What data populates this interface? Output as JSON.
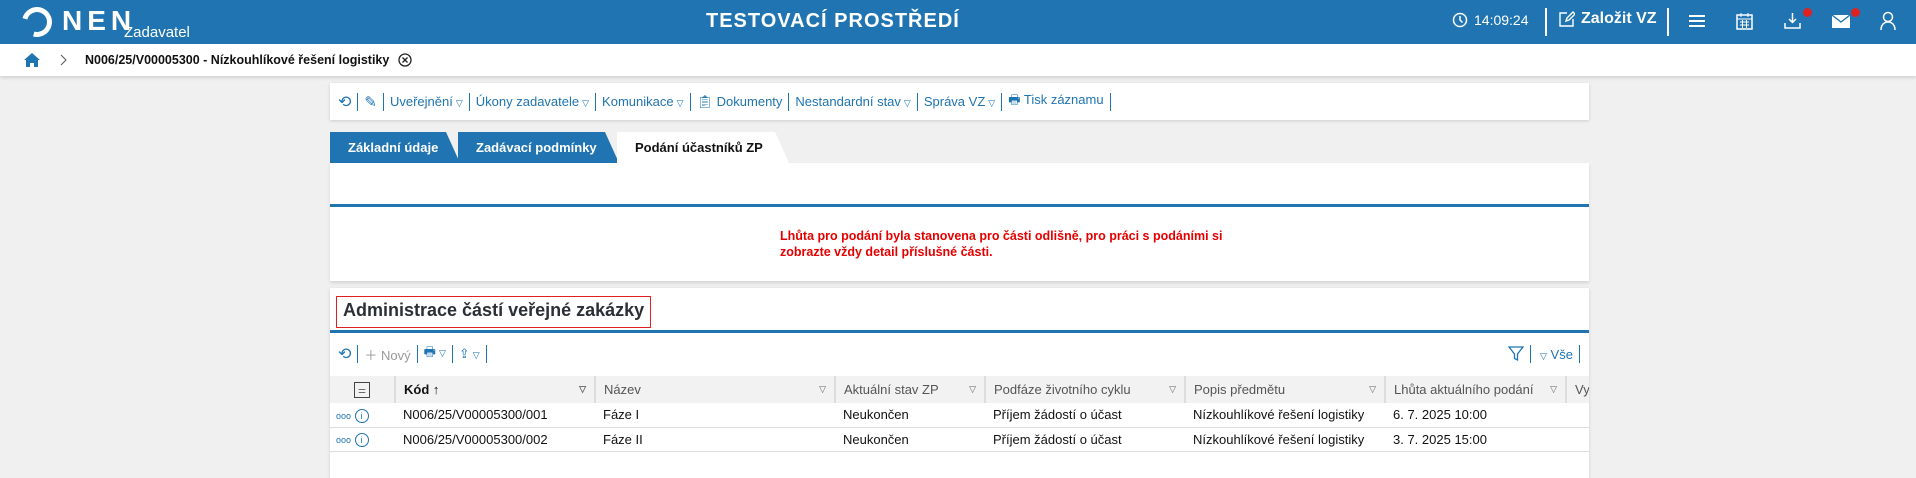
{
  "header": {
    "logo": "NEN",
    "role": "Zadavatel",
    "env_title": "TESTOVACÍ PROSTŘEDÍ",
    "time": "14:09:24",
    "create_label": "Založit VZ",
    "icons": [
      "clock-icon",
      "edit-icon",
      "menu-icon",
      "calendar-icon",
      "download-icon",
      "mail-icon",
      "user-icon"
    ],
    "notification_color": "#d22222"
  },
  "breadcrumb": {
    "current": "N006/25/V00005300 - Nízkouhlíkové řešení logistiky"
  },
  "toolbar": {
    "items": [
      "Uveřejnění",
      "Úkony zadavatele",
      "Komunikace",
      "Dokumenty",
      "Nestandardní stav",
      "Správa VZ",
      "Tisk záznamu"
    ]
  },
  "tabs": [
    {
      "label": "Základní údaje"
    },
    {
      "label": "Zadávací podmínky"
    },
    {
      "label": "Podání účastníků ZP",
      "active": true
    }
  ],
  "message": "Lhůta pro podání byla stanovena pro části odlišně, pro práci s podáními si zobrazte vždy detail příslušné části.",
  "section": {
    "title": "Administrace částí veřejné zakázky",
    "new_label": "Nový",
    "filter_all": "Vše"
  },
  "table": {
    "columns": [
      "Kód",
      "Název",
      "Aktuální stav ZP",
      "Podfáze životního cyklu",
      "Popis předmětu",
      "Lhůta aktuálního podání",
      "Vy"
    ],
    "rows": [
      [
        "N006/25/V00005300/001",
        "Fáze I",
        "Neukončen",
        "Příjem žádostí o účast",
        "Nízkouhlíkové řešení logistiky",
        "6. 7. 2025 10:00"
      ],
      [
        "N006/25/V00005300/002",
        "Fáze II",
        "Neukončen",
        "Příjem žádostí o účast",
        "Nízkouhlíkové řešení logistiky",
        "3. 7. 2025 15:00"
      ]
    ]
  },
  "colors": {
    "brand": "#1f74b1",
    "message": "#e60000"
  }
}
